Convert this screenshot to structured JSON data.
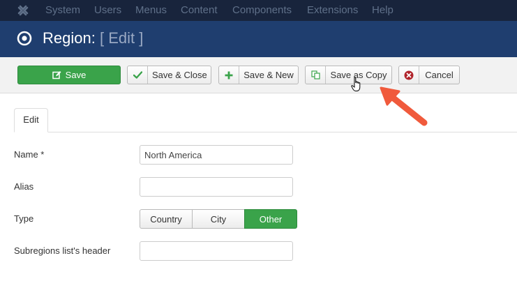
{
  "navbar": {
    "logo": "joomla-logo",
    "items": [
      "System",
      "Users",
      "Menus",
      "Content",
      "Components",
      "Extensions",
      "Help"
    ]
  },
  "header": {
    "title": "Region:",
    "subtitle": "[ Edit ]",
    "icon": "target-icon"
  },
  "toolbar": {
    "save": "Save",
    "save_close": "Save & Close",
    "save_new": "Save & New",
    "save_copy": "Save as Copy",
    "cancel": "Cancel"
  },
  "tabs": [
    "Edit"
  ],
  "form": {
    "name_label": "Name *",
    "name_value": "North America",
    "alias_label": "Alias",
    "alias_value": "",
    "type_label": "Type",
    "type_options": [
      "Country",
      "City",
      "Other"
    ],
    "type_selected": "Other",
    "subregions_label": "Subregions list's header",
    "subregions_value": ""
  },
  "colors": {
    "navbar": "#18243c",
    "titlebar": "#1f3e6f",
    "success": "#3aa34a",
    "danger": "#b0242b",
    "arrow": "#f05a3c"
  }
}
